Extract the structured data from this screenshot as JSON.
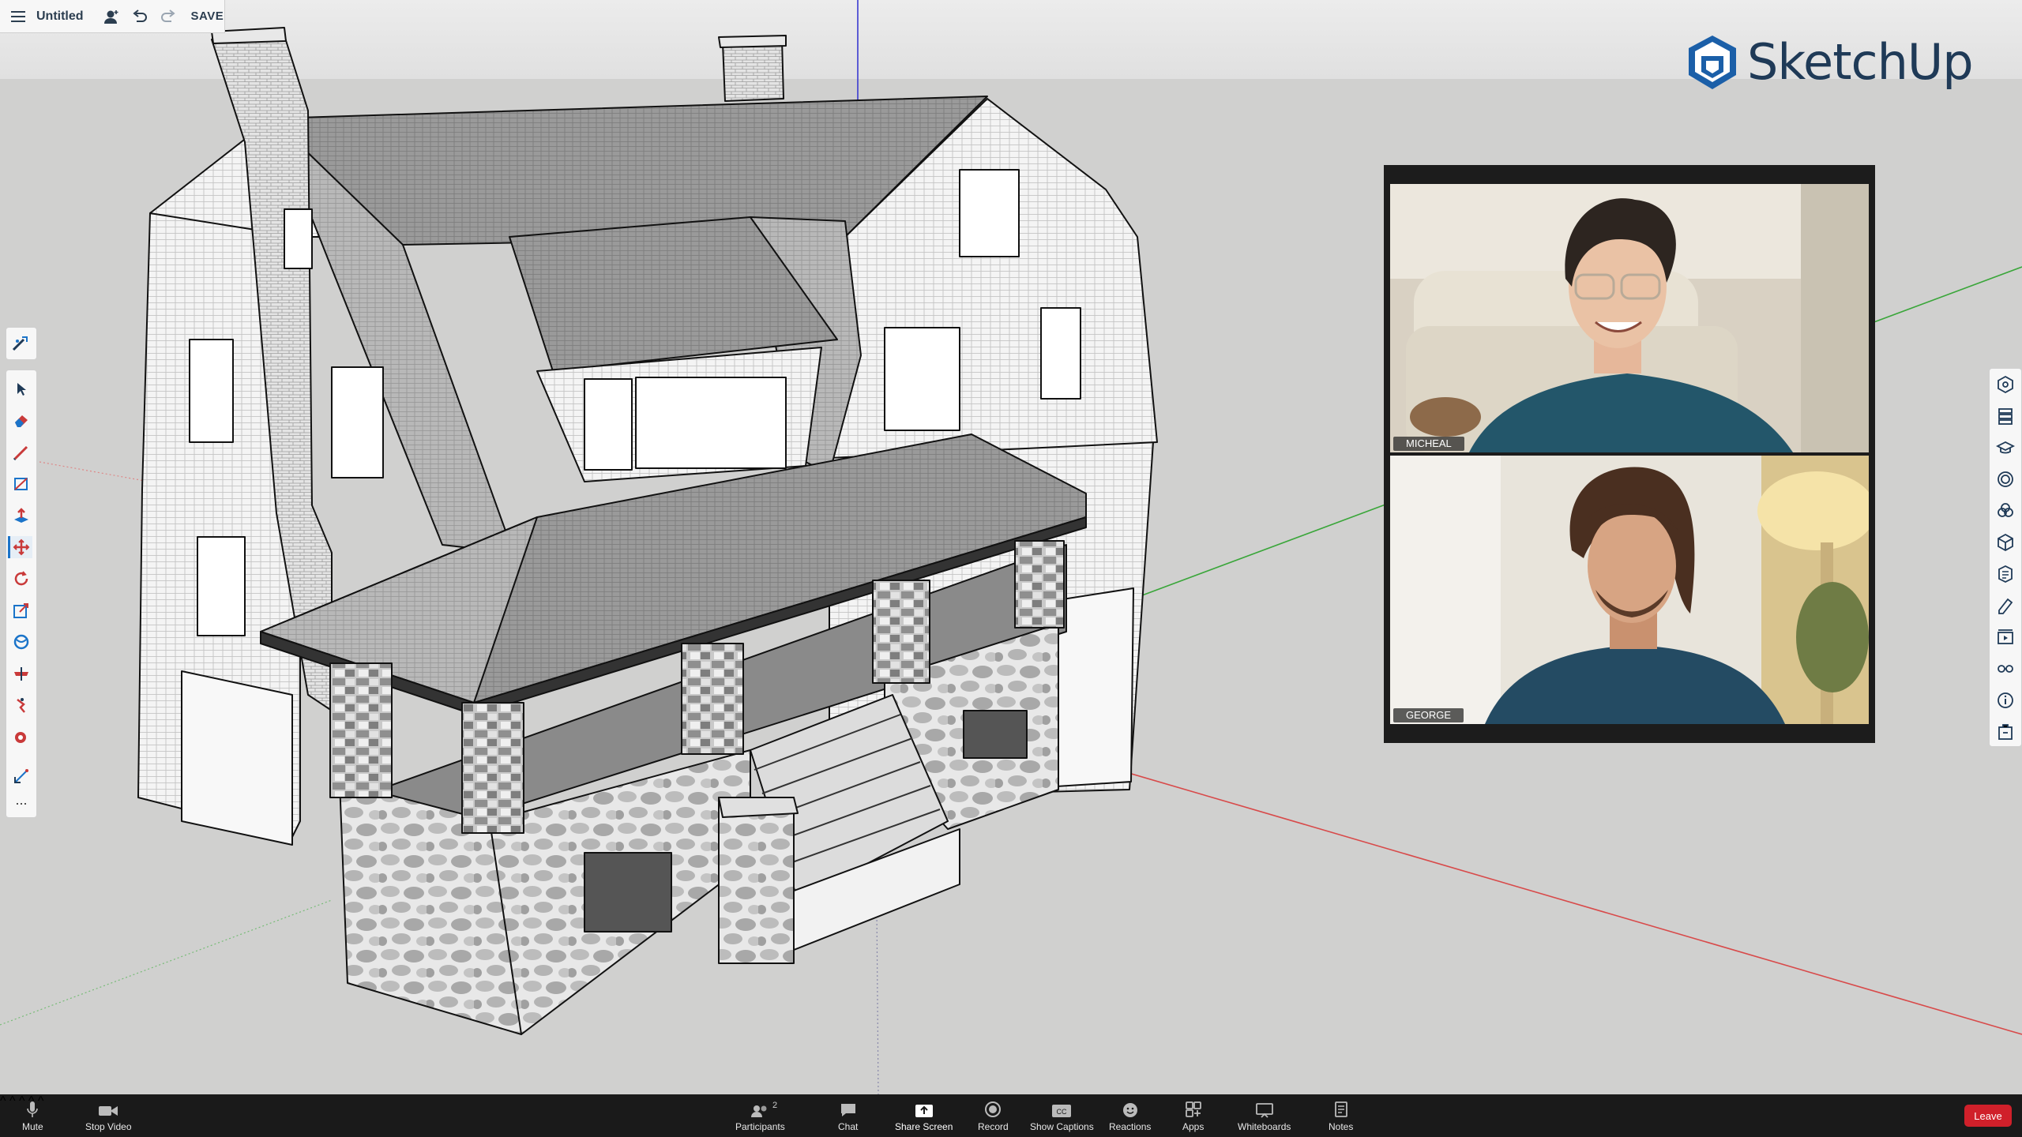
{
  "app": {
    "name": "SketchUp"
  },
  "file": {
    "title": "Untitled",
    "save_label": "SAVE"
  },
  "left_toolbar": {
    "top_tool": "search-tools-icon",
    "tools": [
      {
        "name": "select-tool-icon"
      },
      {
        "name": "eraser-tool-icon"
      },
      {
        "name": "pencil-line-tool-icon"
      },
      {
        "name": "rectangle-tool-icon"
      },
      {
        "name": "push-pull-tool-icon"
      },
      {
        "name": "move-tool-icon",
        "active": true
      },
      {
        "name": "rotate-tool-icon"
      },
      {
        "name": "scale-tool-icon"
      },
      {
        "name": "orbit-tool-icon"
      },
      {
        "name": "section-plane-tool-icon"
      },
      {
        "name": "walk-tool-icon"
      },
      {
        "name": "paint-bucket-tool-icon"
      },
      {
        "name": "tape-measure-tool-icon"
      }
    ],
    "more_label": "..."
  },
  "right_toolbar": {
    "panels": [
      "entity-info-icon",
      "layers-tags-icon",
      "instructor-icon",
      "components-icon",
      "materials-icon",
      "3d-warehouse-icon",
      "outliner-icon",
      "styles-icon",
      "scenes-icon",
      "display-icon",
      "info-icon",
      "extension-icon"
    ]
  },
  "video": {
    "participants": [
      {
        "name": "MICHEAL"
      },
      {
        "name": "GEORGE"
      }
    ]
  },
  "zoom": {
    "controls": [
      {
        "label": "Mute",
        "icon": "microphone-icon"
      },
      {
        "label": "Stop Video",
        "icon": "video-camera-icon"
      },
      {
        "label": "Participants",
        "icon": "participants-icon",
        "count": "2"
      },
      {
        "label": "Chat",
        "icon": "chat-icon"
      },
      {
        "label": "Share Screen",
        "icon": "share-screen-icon"
      },
      {
        "label": "Record",
        "icon": "record-icon"
      },
      {
        "label": "Show Captions",
        "icon": "captions-icon"
      },
      {
        "label": "Reactions",
        "icon": "reactions-icon"
      },
      {
        "label": "Apps",
        "icon": "apps-icon"
      },
      {
        "label": "Whiteboards",
        "icon": "whiteboard-icon"
      },
      {
        "label": "Notes",
        "icon": "notes-icon"
      }
    ],
    "leave_label": "Leave"
  },
  "colors": {
    "accent": "#1b74c9",
    "leave": "#d0202a",
    "logo": "#1f3a57"
  }
}
